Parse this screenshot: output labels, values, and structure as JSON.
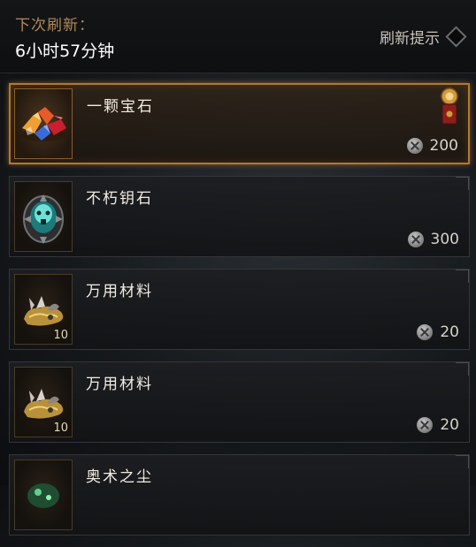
{
  "header": {
    "refresh_label": "下次刷新：",
    "refresh_time": "6小时57分钟",
    "refresh_hint": "刷新提示"
  },
  "items": [
    {
      "name": "一颗宝石",
      "price": "200",
      "quantity": "",
      "icon": "gem-pile-icon",
      "selected": true
    },
    {
      "name": "不朽钥石",
      "price": "300",
      "quantity": "",
      "icon": "keystone-icon",
      "selected": false
    },
    {
      "name": "万用材料",
      "price": "20",
      "quantity": "10",
      "icon": "material-pile-icon",
      "selected": false
    },
    {
      "name": "万用材料",
      "price": "20",
      "quantity": "10",
      "icon": "material-pile-icon",
      "selected": false
    },
    {
      "name": "奥术之尘",
      "price": "",
      "quantity": "",
      "icon": "arcane-dust-icon",
      "selected": false
    }
  ]
}
